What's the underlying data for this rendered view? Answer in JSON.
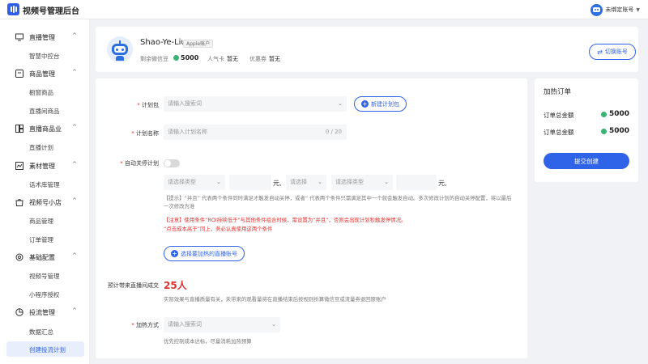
{
  "header": {
    "app_title": "视频号管理后台",
    "account_label": "未绑定账号"
  },
  "sidebar": {
    "sections": [
      {
        "label": "直播管理",
        "icon": "monitor-icon",
        "items": [
          "智慧中控台"
        ]
      },
      {
        "label": "商品管理",
        "icon": "box-icon",
        "items": [
          "橱窗商品",
          "直播间商品"
        ]
      },
      {
        "label": "直播商品业",
        "icon": "grid-icon",
        "items": [
          "直播计划"
        ]
      },
      {
        "label": "素材管理",
        "icon": "image-icon",
        "items": [
          "话术库管理"
        ]
      },
      {
        "label": "视频号小店",
        "icon": "shop-icon",
        "items": [
          "商品管理",
          "订单管理"
        ]
      },
      {
        "label": "基础配置",
        "icon": "gear-icon",
        "items": [
          "视频号管理",
          "小程序授权"
        ]
      },
      {
        "label": "投流管理",
        "icon": "chart-icon",
        "items": [
          "数据汇总",
          "创建投流计划"
        ]
      }
    ],
    "active_item": "创建投流计划"
  },
  "profile": {
    "name": "Shao-Ye-Liu",
    "tag": "Apple账户",
    "balance_label": "剩余微信豆",
    "balance_value": "5000",
    "popularity_label": "人气卡",
    "popularity_value": "暂无",
    "coupon_label": "优惠券",
    "coupon_value": "暂无",
    "switch_button": "切换账号"
  },
  "form": {
    "plan_label": "计划包",
    "plan_placeholder": "请输入搜索词",
    "new_plan_button": "新建计划包",
    "name_label": "计划名称",
    "name_placeholder": "请输入计划名称",
    "name_counter": "0 / 20",
    "auto_close_label": "自动关停计划",
    "cond_select1": "请选择类型",
    "cond_unit1": "元,",
    "cond_select2": "请选择",
    "cond_select3": "请选择类型",
    "cond_unit2": "元,",
    "tip_note": "【提示】“并且” 代表两个条件同时满足才触发自动关停，或者” 代表两个条件只需满足其中一个就会触发自动。多次修改计划的自动关停配置，将以最后一次修改为准",
    "warn_line1": "【注意】使用条件“ROI持续低于”与其他条件组合时候，需设置为“并且”，否则会出现计划秒触发停情况。",
    "warn_line2": "“点击成本高于”同上，务必认真使用这两个条件",
    "select_account_button": "选择要加热的直播账号",
    "estimate_label": "预计带来直播间成交",
    "estimate_value": "25人",
    "estimate_note": "实际效果与直播质量有关，未带来的观看量将在直播结束后按规则折算微信豆或流量券退回原账户",
    "heat_label": "加热方式",
    "heat_placeholder": "请输入搜索词",
    "heat_note": "优先控制成本达标，尽量消耗加热预算"
  },
  "order": {
    "title": "加热订单",
    "rows": [
      {
        "label": "订单总金额",
        "value": "5000"
      },
      {
        "label": "订单总金额",
        "value": "5000"
      }
    ],
    "submit": "提交创建"
  },
  "colors": {
    "accent": "#2f63e8",
    "danger": "#e0312f",
    "coin": "#3bb273"
  }
}
